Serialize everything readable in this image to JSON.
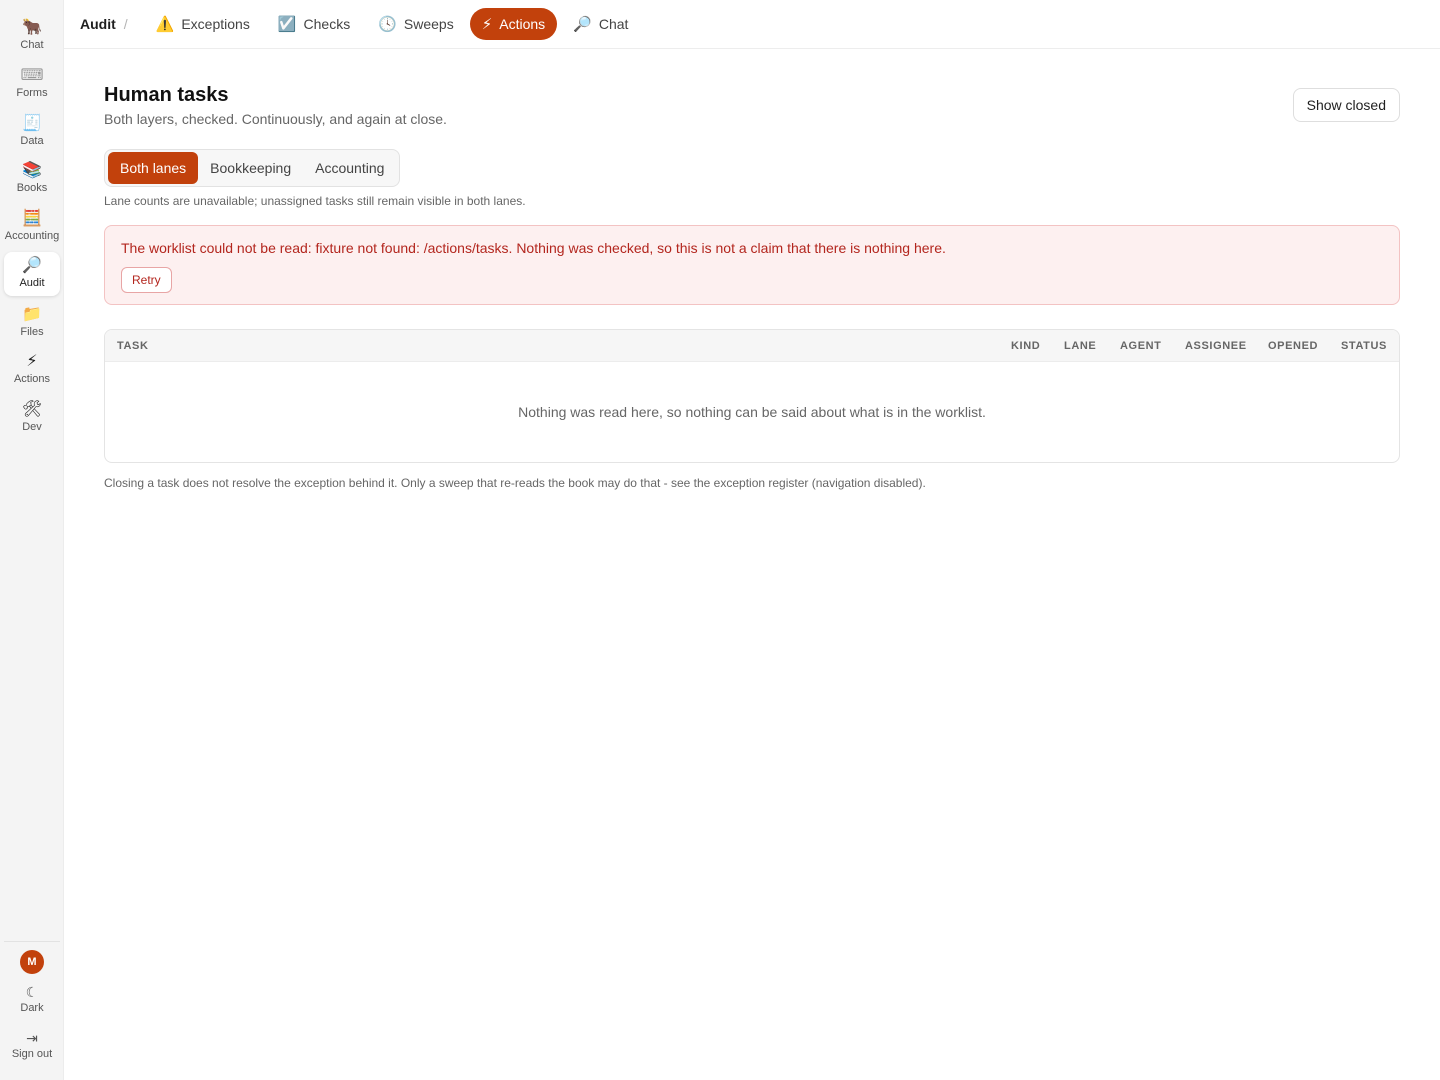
{
  "sidebar": {
    "items": [
      {
        "label": "Chat",
        "icon": "🐂",
        "icon_name": "ox-icon"
      },
      {
        "label": "Forms",
        "icon": "⌨",
        "icon_name": "keyboard-icon"
      },
      {
        "label": "Data",
        "icon": "🧾",
        "icon_name": "receipt-icon"
      },
      {
        "label": "Books",
        "icon": "📚",
        "icon_name": "books-icon"
      },
      {
        "label": "Accounting",
        "icon": "🧮",
        "icon_name": "abacus-icon"
      },
      {
        "label": "Audit",
        "icon": "🔎",
        "icon_name": "magnifier-icon"
      },
      {
        "label": "Files",
        "icon": "📁",
        "icon_name": "folder-icon"
      },
      {
        "label": "Actions",
        "icon": "⚡",
        "icon_name": "lightning-icon"
      },
      {
        "label": "Dev",
        "icon": "🛠",
        "icon_name": "tools-icon"
      }
    ],
    "active": "Audit",
    "avatar_initial": "M",
    "dark_label": "Dark",
    "dark_icon": "☾",
    "signout_label": "Sign out",
    "signout_icon": "⇥"
  },
  "topbar": {
    "breadcrumb": "Audit",
    "separator": "/",
    "tabs": [
      {
        "label": "Exceptions",
        "icon": "⚠️",
        "icon_name": "warning-icon"
      },
      {
        "label": "Checks",
        "icon": "☑️",
        "icon_name": "check-box-icon"
      },
      {
        "label": "Sweeps",
        "icon": "🕓",
        "icon_name": "clock-icon"
      },
      {
        "label": "Actions",
        "icon": "⚡",
        "icon_name": "lightning-icon"
      },
      {
        "label": "Chat",
        "icon": "🔎",
        "icon_name": "magnifier-icon"
      }
    ],
    "active_tab": "Actions"
  },
  "page": {
    "title": "Human tasks",
    "subtitle": "Both layers, checked. Continuously, and again at close.",
    "show_closed_label": "Show closed"
  },
  "lanes": {
    "options": [
      "Both lanes",
      "Bookkeeping",
      "Accounting"
    ],
    "active": "Both lanes",
    "note": "Lane counts are unavailable; unassigned tasks still remain visible in both lanes."
  },
  "error": {
    "message": "The worklist could not be read: fixture not found: /actions/tasks. Nothing was checked, so this is not a claim that there is nothing here.",
    "retry_label": "Retry"
  },
  "table": {
    "columns": [
      "TASK",
      "KIND",
      "LANE",
      "AGENT",
      "ASSIGNEE",
      "OPENED",
      "STATUS"
    ],
    "empty_message": "Nothing was read here, so nothing can be said about what is in the worklist."
  },
  "footer_note": "Closing a task does not resolve the exception behind it. Only a sweep that re-reads the book may do that - see the exception register (navigation disabled).",
  "colors": {
    "accent": "#c2410c",
    "error_text": "#b3261e",
    "error_bg": "#fdf0f0"
  }
}
